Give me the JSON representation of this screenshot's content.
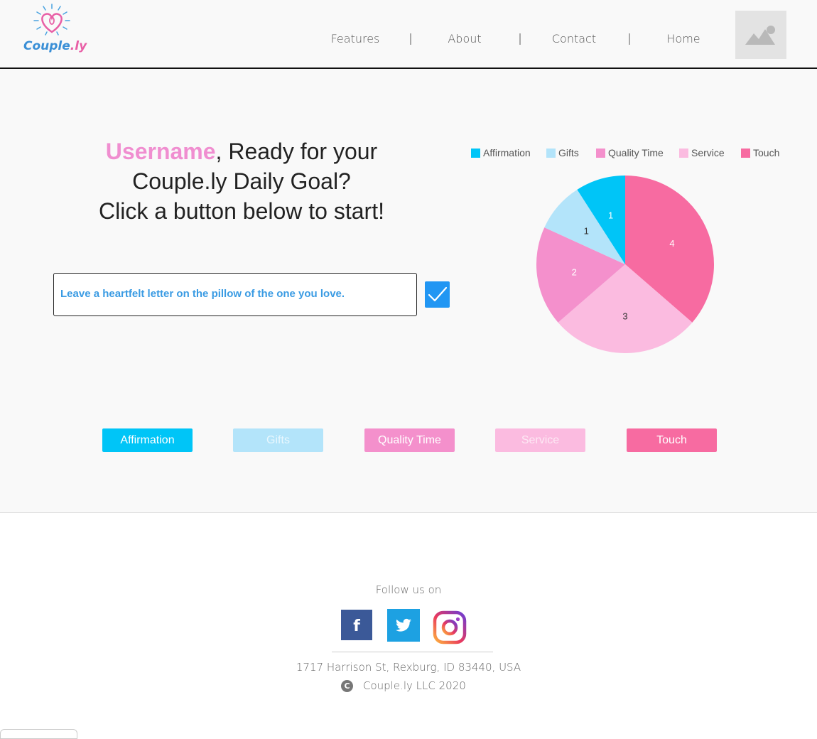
{
  "brand": {
    "name_part1": "Couple",
    "name_part2": ".ly"
  },
  "nav": {
    "items": [
      "Features",
      "About",
      "Contact",
      "Home"
    ]
  },
  "hero": {
    "username": "Username",
    "line1_rest": ", Ready for your",
    "line2": "Couple.ly Daily Goal?",
    "line3": "Click a button below to start!"
  },
  "goal": {
    "text": "Leave a heartfelt letter on the pillow of the one you love."
  },
  "categories": [
    {
      "label": "Affirmation",
      "color": "#00c5f7",
      "text_color": "#ffffff"
    },
    {
      "label": "Gifts",
      "color": "#b3e4fa",
      "text_color": "#e8f7fe"
    },
    {
      "label": "Quality Time",
      "color": "#f490cc",
      "text_color": "#ffffff"
    },
    {
      "label": "Service",
      "color": "#fbbbe0",
      "text_color": "#fde8f4"
    },
    {
      "label": "Touch",
      "color": "#f76ba1",
      "text_color": "#ffffff"
    }
  ],
  "chart_data": {
    "type": "pie",
    "legend_position": "top",
    "series": [
      {
        "name": "Affirmation",
        "value": 1,
        "color": "#00c5f7"
      },
      {
        "name": "Gifts",
        "value": 1,
        "color": "#b3e4fa"
      },
      {
        "name": "Quality Time",
        "value": 2,
        "color": "#f490cc"
      },
      {
        "name": "Service",
        "value": 3,
        "color": "#fbbbe0"
      },
      {
        "name": "Touch",
        "value": 4,
        "color": "#f76ba1"
      }
    ]
  },
  "footer": {
    "follow_label": "Follow us on",
    "social": [
      "facebook",
      "twitter",
      "instagram"
    ],
    "address": "1717 Harrison St, Rexburg, ID 83440, USA",
    "copyright": "Couple.ly LLC 2020"
  }
}
